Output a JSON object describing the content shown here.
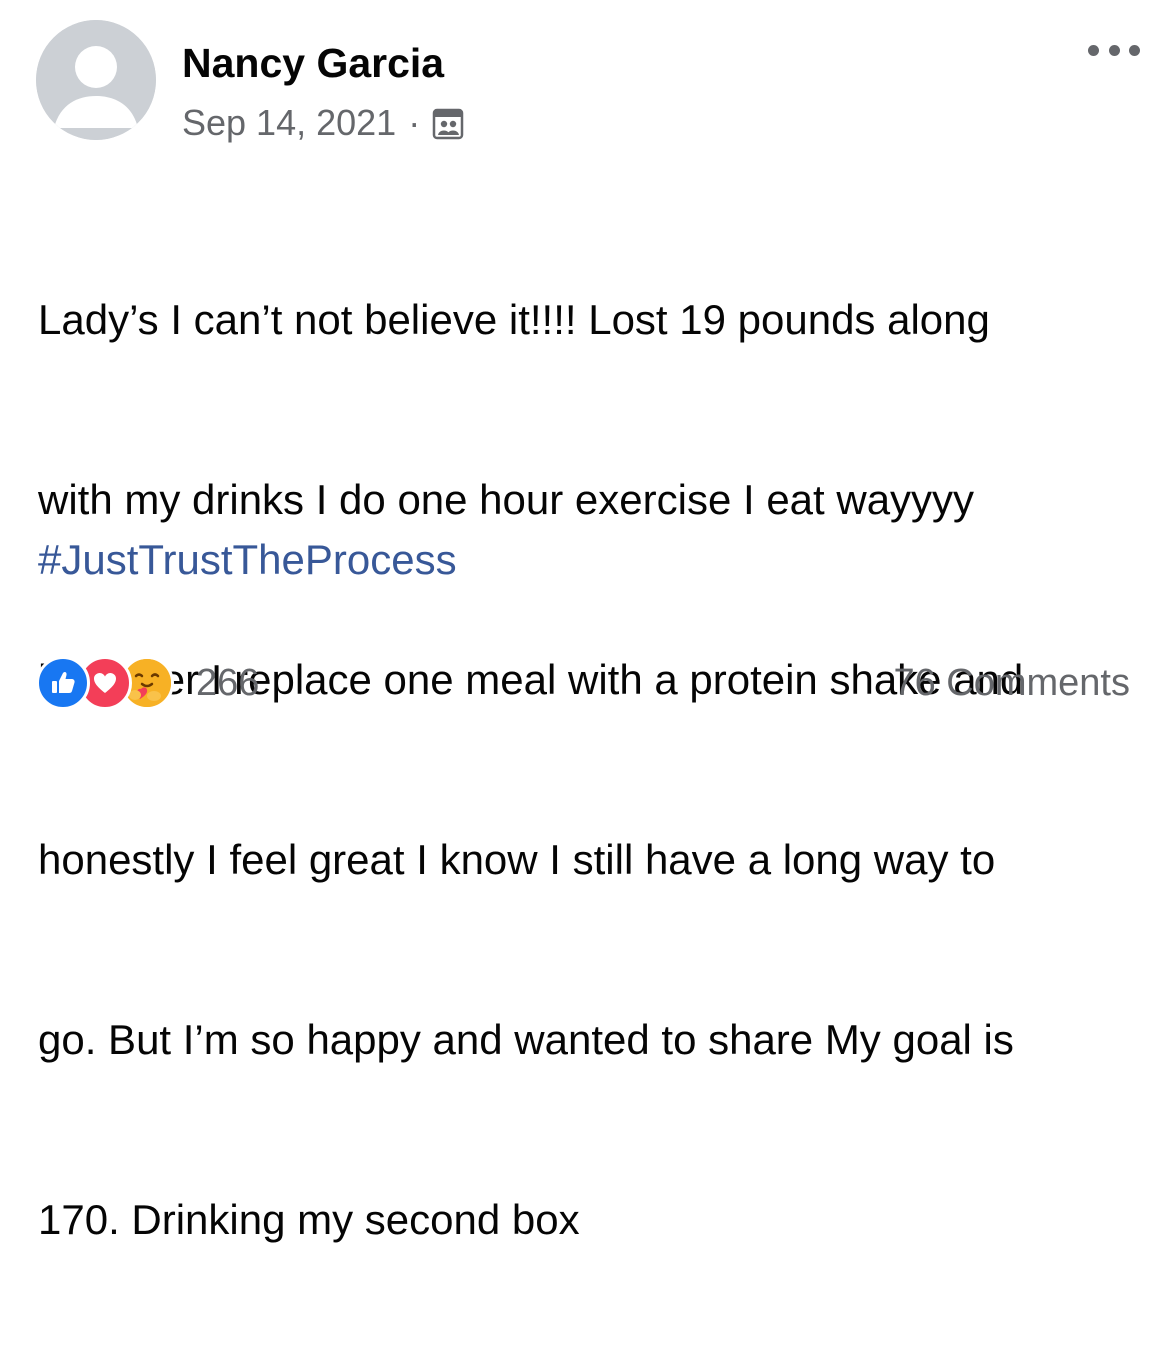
{
  "post": {
    "author": "Nancy Garcia",
    "date": "Sep 14, 2021",
    "separator": "·",
    "audience_icon": "group-audience-icon",
    "more_icon": "more-options-icon",
    "body_lines": [
      "Lady’s I can’t not believe it!!!!  Lost 19 pounds along",
      "with my drinks I do one hour exercise I eat wayyyy",
      "healthier I replace one meal with a protein shake and",
      "honestly I feel great I know I still have a long way to",
      "go. But I’m so happy and wanted to share My goal is",
      "170. Drinking my second box"
    ],
    "hashtag": "#JustTrustTheProcess",
    "reactions": {
      "types": [
        "like-icon",
        "love-icon",
        "care-icon"
      ],
      "count": "266"
    },
    "comments_label": "76 Comments"
  },
  "colors": {
    "text": "#050505",
    "secondary": "#65676b",
    "link": "#385898",
    "like": "#1877f2",
    "love": "#f33e58",
    "care": "#f7b125",
    "avatar_bg": "#ccd0d5"
  }
}
